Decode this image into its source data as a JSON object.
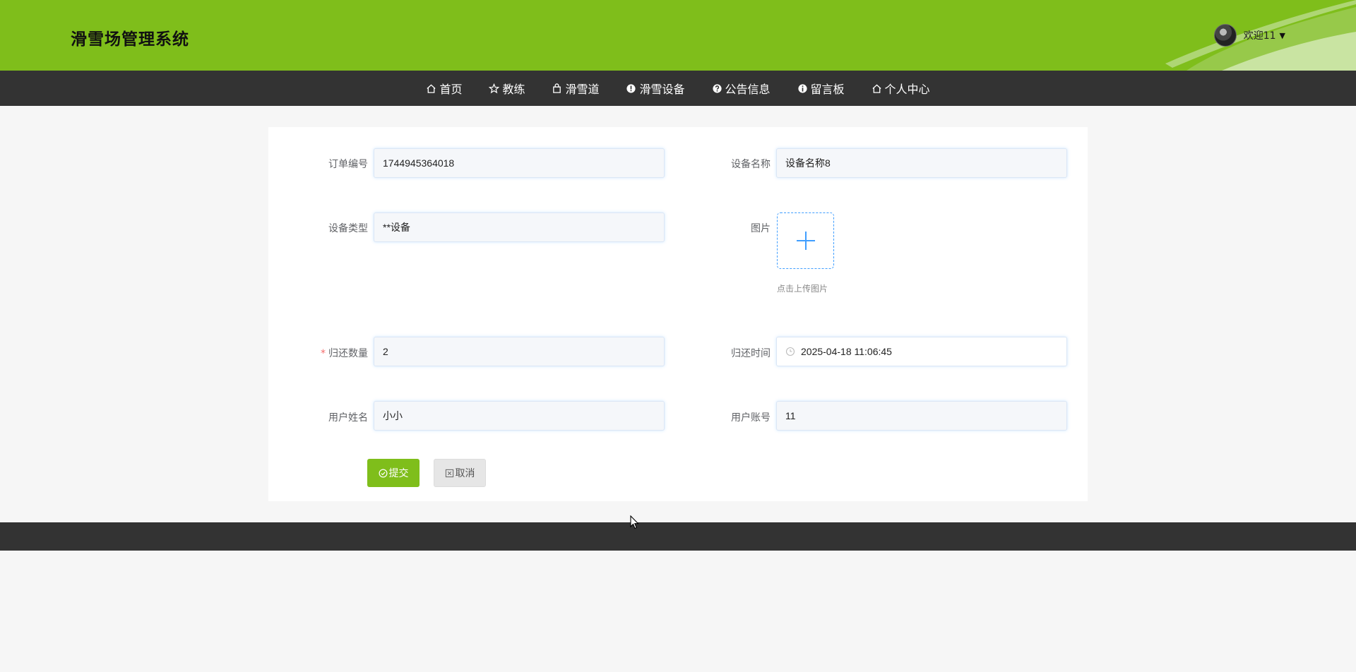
{
  "header": {
    "title": "滑雪场管理系统",
    "welcome": "欢迎11",
    "caret": "▼"
  },
  "nav": {
    "items": [
      {
        "label": "首页",
        "icon": "home-icon"
      },
      {
        "label": "教练",
        "icon": "star-icon"
      },
      {
        "label": "滑雪道",
        "icon": "bag-icon"
      },
      {
        "label": "滑雪设备",
        "icon": "warning-icon"
      },
      {
        "label": "公告信息",
        "icon": "question-icon"
      },
      {
        "label": "留言板",
        "icon": "info-icon"
      },
      {
        "label": "个人中心",
        "icon": "home-icon"
      }
    ]
  },
  "form": {
    "order_no": {
      "label": "订单编号",
      "value": "1744945364018"
    },
    "device_name": {
      "label": "设备名称",
      "value": "设备名称8"
    },
    "device_type": {
      "label": "设备类型",
      "value": "**设备"
    },
    "image": {
      "label": "图片",
      "tip": "点击上传图片"
    },
    "return_qty": {
      "label": "归还数量",
      "value": "2",
      "required_mark": "*"
    },
    "return_time": {
      "label": "归还时间",
      "value": "2025-04-18 11:06:45"
    },
    "user_name": {
      "label": "用户姓名",
      "value": "小小"
    },
    "user_account": {
      "label": "用户账号",
      "value": "11"
    },
    "submit_label": "提交",
    "cancel_label": "取消"
  },
  "colors": {
    "brand": "#7fbe1b",
    "nav_bg": "#333333",
    "accent": "#409eff"
  }
}
